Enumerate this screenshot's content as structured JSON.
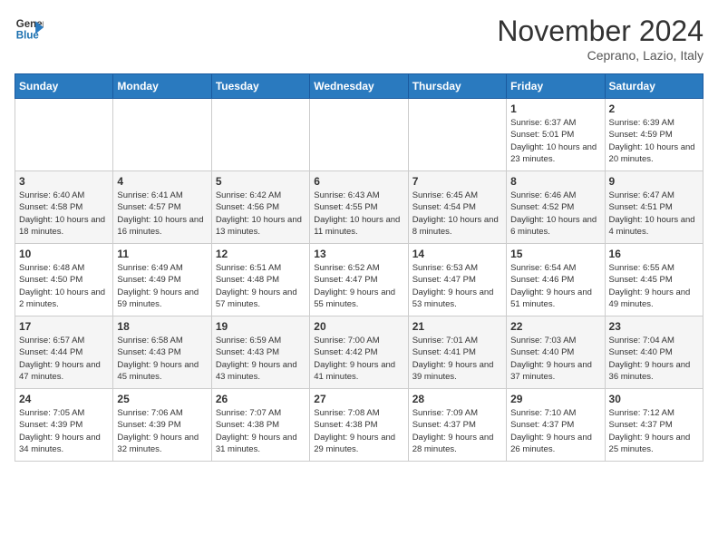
{
  "header": {
    "logo_line1": "General",
    "logo_line2": "Blue",
    "month_title": "November 2024",
    "location": "Ceprano, Lazio, Italy"
  },
  "weekdays": [
    "Sunday",
    "Monday",
    "Tuesday",
    "Wednesday",
    "Thursday",
    "Friday",
    "Saturday"
  ],
  "weeks": [
    [
      {
        "day": "",
        "info": ""
      },
      {
        "day": "",
        "info": ""
      },
      {
        "day": "",
        "info": ""
      },
      {
        "day": "",
        "info": ""
      },
      {
        "day": "",
        "info": ""
      },
      {
        "day": "1",
        "info": "Sunrise: 6:37 AM\nSunset: 5:01 PM\nDaylight: 10 hours and 23 minutes."
      },
      {
        "day": "2",
        "info": "Sunrise: 6:39 AM\nSunset: 4:59 PM\nDaylight: 10 hours and 20 minutes."
      }
    ],
    [
      {
        "day": "3",
        "info": "Sunrise: 6:40 AM\nSunset: 4:58 PM\nDaylight: 10 hours and 18 minutes."
      },
      {
        "day": "4",
        "info": "Sunrise: 6:41 AM\nSunset: 4:57 PM\nDaylight: 10 hours and 16 minutes."
      },
      {
        "day": "5",
        "info": "Sunrise: 6:42 AM\nSunset: 4:56 PM\nDaylight: 10 hours and 13 minutes."
      },
      {
        "day": "6",
        "info": "Sunrise: 6:43 AM\nSunset: 4:55 PM\nDaylight: 10 hours and 11 minutes."
      },
      {
        "day": "7",
        "info": "Sunrise: 6:45 AM\nSunset: 4:54 PM\nDaylight: 10 hours and 8 minutes."
      },
      {
        "day": "8",
        "info": "Sunrise: 6:46 AM\nSunset: 4:52 PM\nDaylight: 10 hours and 6 minutes."
      },
      {
        "day": "9",
        "info": "Sunrise: 6:47 AM\nSunset: 4:51 PM\nDaylight: 10 hours and 4 minutes."
      }
    ],
    [
      {
        "day": "10",
        "info": "Sunrise: 6:48 AM\nSunset: 4:50 PM\nDaylight: 10 hours and 2 minutes."
      },
      {
        "day": "11",
        "info": "Sunrise: 6:49 AM\nSunset: 4:49 PM\nDaylight: 9 hours and 59 minutes."
      },
      {
        "day": "12",
        "info": "Sunrise: 6:51 AM\nSunset: 4:48 PM\nDaylight: 9 hours and 57 minutes."
      },
      {
        "day": "13",
        "info": "Sunrise: 6:52 AM\nSunset: 4:47 PM\nDaylight: 9 hours and 55 minutes."
      },
      {
        "day": "14",
        "info": "Sunrise: 6:53 AM\nSunset: 4:47 PM\nDaylight: 9 hours and 53 minutes."
      },
      {
        "day": "15",
        "info": "Sunrise: 6:54 AM\nSunset: 4:46 PM\nDaylight: 9 hours and 51 minutes."
      },
      {
        "day": "16",
        "info": "Sunrise: 6:55 AM\nSunset: 4:45 PM\nDaylight: 9 hours and 49 minutes."
      }
    ],
    [
      {
        "day": "17",
        "info": "Sunrise: 6:57 AM\nSunset: 4:44 PM\nDaylight: 9 hours and 47 minutes."
      },
      {
        "day": "18",
        "info": "Sunrise: 6:58 AM\nSunset: 4:43 PM\nDaylight: 9 hours and 45 minutes."
      },
      {
        "day": "19",
        "info": "Sunrise: 6:59 AM\nSunset: 4:43 PM\nDaylight: 9 hours and 43 minutes."
      },
      {
        "day": "20",
        "info": "Sunrise: 7:00 AM\nSunset: 4:42 PM\nDaylight: 9 hours and 41 minutes."
      },
      {
        "day": "21",
        "info": "Sunrise: 7:01 AM\nSunset: 4:41 PM\nDaylight: 9 hours and 39 minutes."
      },
      {
        "day": "22",
        "info": "Sunrise: 7:03 AM\nSunset: 4:40 PM\nDaylight: 9 hours and 37 minutes."
      },
      {
        "day": "23",
        "info": "Sunrise: 7:04 AM\nSunset: 4:40 PM\nDaylight: 9 hours and 36 minutes."
      }
    ],
    [
      {
        "day": "24",
        "info": "Sunrise: 7:05 AM\nSunset: 4:39 PM\nDaylight: 9 hours and 34 minutes."
      },
      {
        "day": "25",
        "info": "Sunrise: 7:06 AM\nSunset: 4:39 PM\nDaylight: 9 hours and 32 minutes."
      },
      {
        "day": "26",
        "info": "Sunrise: 7:07 AM\nSunset: 4:38 PM\nDaylight: 9 hours and 31 minutes."
      },
      {
        "day": "27",
        "info": "Sunrise: 7:08 AM\nSunset: 4:38 PM\nDaylight: 9 hours and 29 minutes."
      },
      {
        "day": "28",
        "info": "Sunrise: 7:09 AM\nSunset: 4:37 PM\nDaylight: 9 hours and 28 minutes."
      },
      {
        "day": "29",
        "info": "Sunrise: 7:10 AM\nSunset: 4:37 PM\nDaylight: 9 hours and 26 minutes."
      },
      {
        "day": "30",
        "info": "Sunrise: 7:12 AM\nSunset: 4:37 PM\nDaylight: 9 hours and 25 minutes."
      }
    ]
  ]
}
